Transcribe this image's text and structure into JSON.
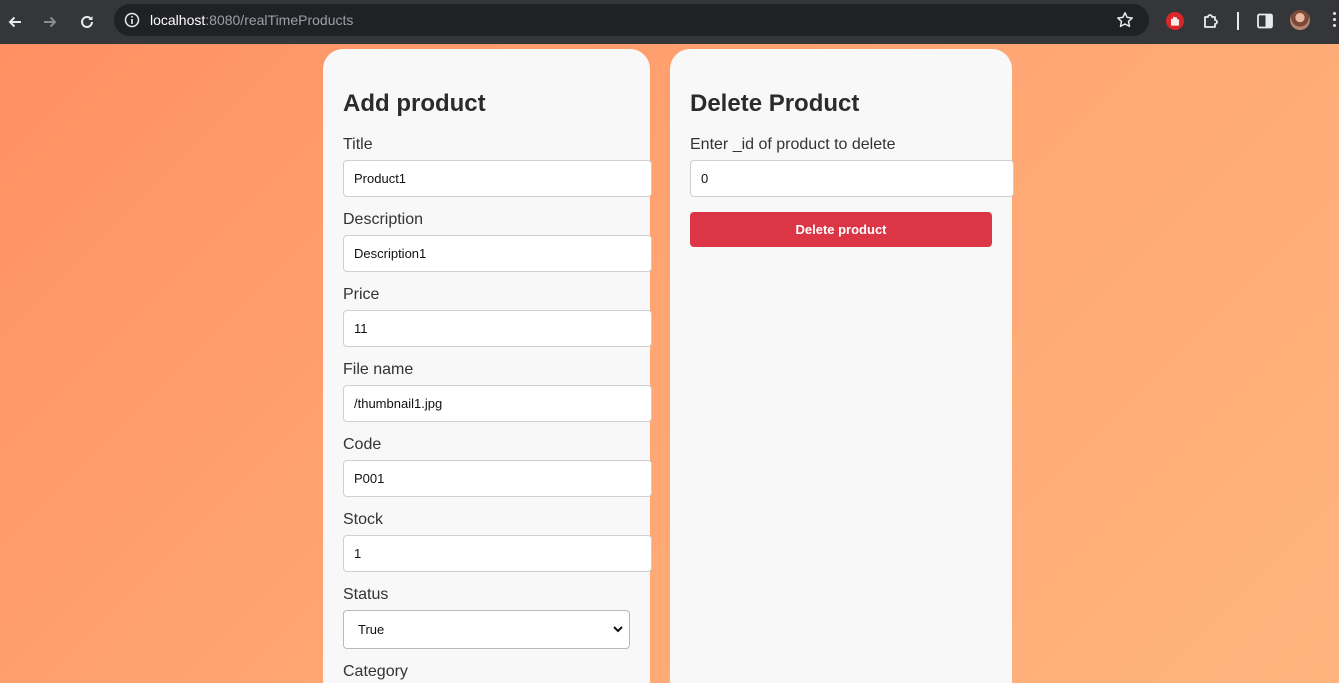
{
  "browser": {
    "url_host": "localhost",
    "url_path": ":8080/realTimeProducts",
    "icons": [
      "back-arrow-icon",
      "forward-arrow-icon",
      "reload-icon",
      "site-info-icon",
      "bookmark-star-icon",
      "extension-stop-icon",
      "extensions-puzzle-icon",
      "side-panel-icon",
      "profile-avatar",
      "menu-kebab-icon"
    ]
  },
  "add_form": {
    "title": "Add product",
    "fields": [
      {
        "label": "Title",
        "value": "Product1"
      },
      {
        "label": "Description",
        "value": "Description1"
      },
      {
        "label": "Price",
        "value": "11"
      },
      {
        "label": "File name",
        "value": "/thumbnail1.jpg"
      },
      {
        "label": "Code",
        "value": "P001"
      },
      {
        "label": "Stock",
        "value": "1"
      }
    ],
    "status": {
      "label": "Status",
      "selected": "True"
    },
    "category": {
      "label": "Category"
    }
  },
  "delete_form": {
    "title": "Delete Product",
    "label": "Enter _id of product to delete",
    "value": "0",
    "button": "Delete product"
  },
  "colors": {
    "background_start": "#ff8f62",
    "background_end": "#ffb47e",
    "card": "#f8f8f8",
    "delete_button": "#dc3545",
    "chrome": "#35363a",
    "omnibox": "#202124"
  }
}
